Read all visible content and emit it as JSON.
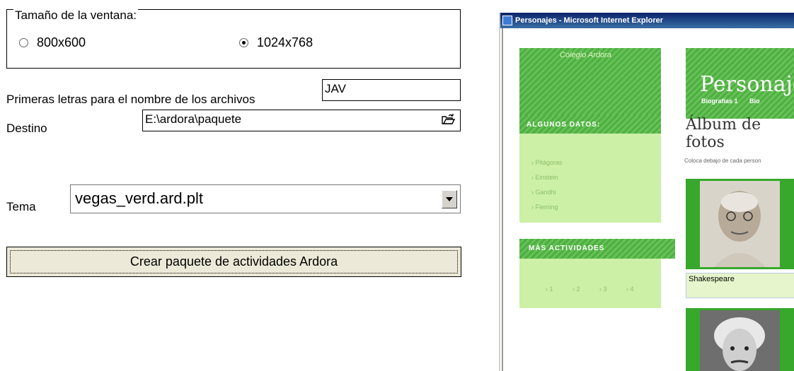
{
  "window_size": {
    "legend": "Tamaño de la ventana:",
    "option_800": "800x600",
    "option_1024": "1024x768",
    "selected": "1024x768"
  },
  "prefix": {
    "label": "Primeras letras para el nombre de los archivos",
    "value": "JAV"
  },
  "destination": {
    "label": "Destino",
    "value": "E:\\ardora\\paquete",
    "browse_icon": "folder-open-icon"
  },
  "theme": {
    "label": "Tema",
    "value": "vegas_verd.ard.plt",
    "dropdown_icon": "chevron-down-icon"
  },
  "create_button": "Crear paquete de actividades Ardora",
  "preview": {
    "window_title": "Personajes - Microsoft Internet Explorer",
    "site_name": "Colegio Ardora",
    "page_title": "Personaje",
    "nav": [
      "Biografías 1",
      "Bio"
    ],
    "sidebar_section_1": "ALGUNOS DATOS:",
    "sidebar_links": [
      "Pitágoras",
      "Einstein",
      "Gandhi",
      "Fleming"
    ],
    "sidebar_section_2": "MÁS ACTIVIDADES",
    "activity_links": [
      "1",
      "2",
      "3",
      "4"
    ],
    "album_title": "Álbum de fotos",
    "album_desc": "Coloca debajo de cada person",
    "caption": "Shakespeare",
    "colors": {
      "green": "#4fae42",
      "light_green": "#ccf0a6",
      "titlebar": "#0a246a"
    }
  }
}
